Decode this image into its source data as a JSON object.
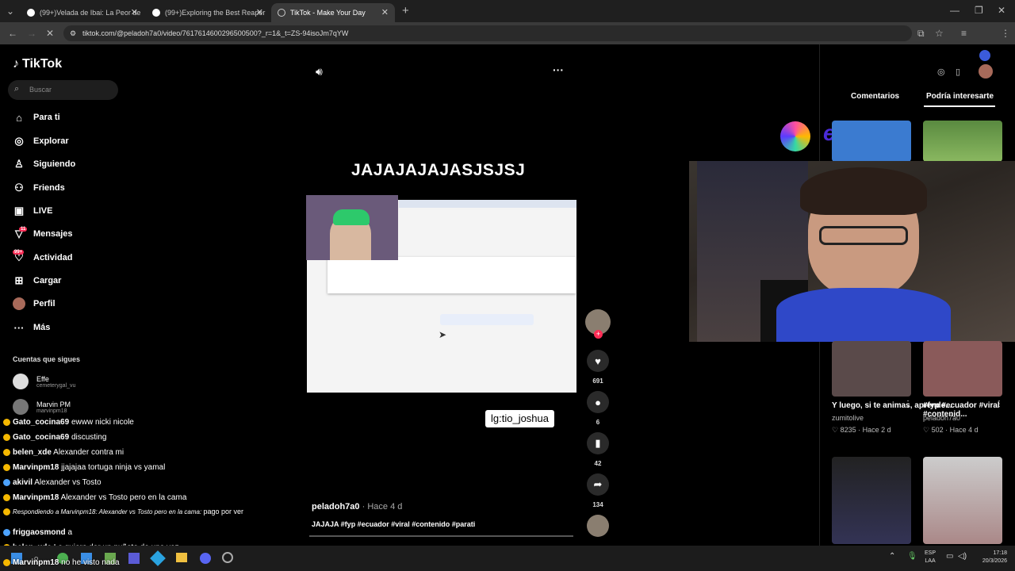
{
  "browser": {
    "tabs": [
      {
        "title": "(99+)Velada de Ibai: La Peor de"
      },
      {
        "title": "(99+)Exploring the Best Reaper"
      },
      {
        "title": "TikTok - Make Your Day"
      }
    ],
    "url": "tiktok.com/@peladoh7a0/video/7617614600296500500?_r=1&_t=ZS-94isoJm7qYW"
  },
  "sidebar": {
    "logo": "TikTok",
    "search_placeholder": "Buscar",
    "nav": [
      {
        "label": "Para ti",
        "icon": "home-icon"
      },
      {
        "label": "Explorar",
        "icon": "compass-icon"
      },
      {
        "label": "Siguiendo",
        "icon": "following-icon"
      },
      {
        "label": "Friends",
        "icon": "friends-icon"
      },
      {
        "label": "LIVE",
        "icon": "live-icon"
      },
      {
        "label": "Mensajes",
        "icon": "message-icon",
        "badge": "11"
      },
      {
        "label": "Actividad",
        "icon": "activity-icon",
        "badge": "99+"
      },
      {
        "label": "Cargar",
        "icon": "upload-icon"
      },
      {
        "label": "Perfil",
        "icon": "profile-icon"
      },
      {
        "label": "Más",
        "icon": "more-icon"
      }
    ],
    "following_header": "Cuentas que sigues",
    "following": [
      {
        "name": "Effe",
        "user": "cemeterygal_vu"
      },
      {
        "name": "Marvin PM",
        "user": "marvinpm18"
      }
    ]
  },
  "chat": [
    {
      "user": "Gato_cocina69",
      "msg": "ewww nicki nicole"
    },
    {
      "user": "Gato_cocina69",
      "msg": "discusting"
    },
    {
      "user": "belen_xde",
      "msg": "Alexander contra mi"
    },
    {
      "user": "Marvinpm18",
      "msg": "jjajajaa tortuga ninja vs yamal"
    },
    {
      "user": "akivil",
      "msg": "Alexander vs Tosto"
    },
    {
      "user": "Marvinpm18",
      "msg": "Alexander vs Tosto pero en la cama"
    },
    {
      "user": "Respondiendo a Marvinpm18: Alexander vs Tosto pero en la cama:",
      "msg": "pago por ver"
    },
    {
      "user": "friggaosmond",
      "msg": "a"
    },
    {
      "user": "belen_xde",
      "msg": "Le quiero dar un puñete de una vez"
    },
    {
      "user": "Marvinpm18",
      "msg": "no he visto nada"
    }
  ],
  "video": {
    "caption_overlay": "JAJAJAJAJASJSJSJ",
    "watermark": "lg:tio_joshua",
    "author": "peladoh7a0",
    "time": "Hace 4 d",
    "description": "JAJAJA #fyp #ecuador #viral #contenido #parati",
    "likes": "691",
    "comments": "6",
    "saves": "42",
    "shares": "134"
  },
  "right_panel": {
    "tabs": [
      "Comentarios",
      "Podría interesarte"
    ],
    "sponsor": "eneba",
    "recs": [
      {
        "title": "Y luego, si te animas, aprende...",
        "author": "zumitolive",
        "likes": "8235",
        "time": "Hace 2 d"
      },
      {
        "title": "#fyp #ecuador #viral #contenid...",
        "author": "peladoh7a0",
        "likes": "502",
        "time": "Hace 4 d"
      }
    ]
  },
  "taskbar": {
    "lang": "ESP",
    "lang2": "LAA",
    "time": "17:18",
    "date": "20/3/2026"
  }
}
